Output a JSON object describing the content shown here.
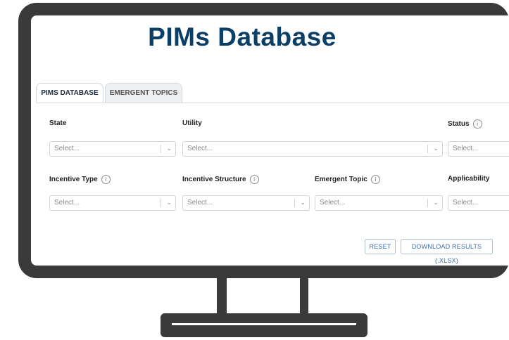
{
  "page": {
    "title": "PIMs Database"
  },
  "tabs": [
    {
      "label": "PIMS DATABASE",
      "active": true
    },
    {
      "label": "EMERGENT TOPICS",
      "active": false
    }
  ],
  "filters": {
    "state": {
      "label": "State",
      "placeholder": "Select..."
    },
    "utility": {
      "label": "Utility",
      "placeholder": "Select..."
    },
    "status": {
      "label": "Status",
      "placeholder": "Select..."
    },
    "incentive_type": {
      "label": "Incentive Type",
      "placeholder": "Select..."
    },
    "incentive_structure": {
      "label": "Incentive Structure",
      "placeholder": "Select..."
    },
    "emergent_topic": {
      "label": "Emergent Topic",
      "placeholder": "Select..."
    },
    "applicability": {
      "label": "Applicability",
      "placeholder": "Select..."
    }
  },
  "icons": {
    "info": "info-icon",
    "dropdown": "chevron-down-icon"
  },
  "glyphs": {
    "info": "i",
    "chevron": "⌄"
  },
  "actions": {
    "reset_label": "RESET",
    "download_label": "DOWNLOAD RESULTS (.XLSX)"
  },
  "colors": {
    "title": "#0b3f66",
    "button_text": "#3f6ea8",
    "frame": "#3a3a3a"
  }
}
